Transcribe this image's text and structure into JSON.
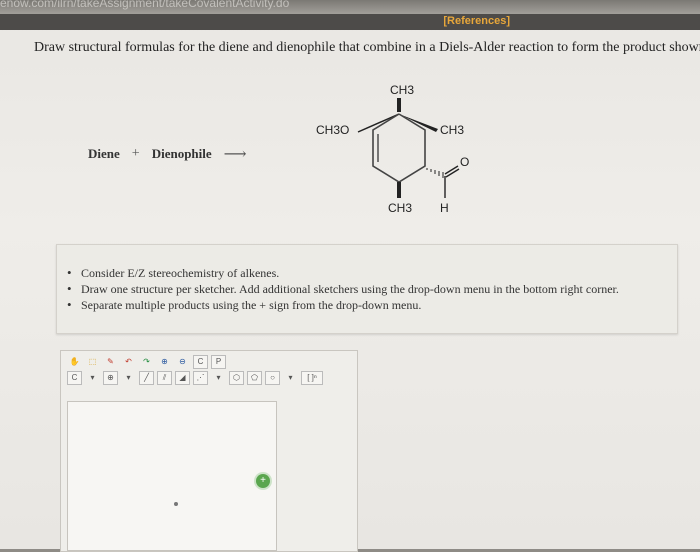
{
  "browser": {
    "url_fragment": "enow.com/ilrn/takeAssignment/takeCovalentActivity.do"
  },
  "header": {
    "references_label": "[References]"
  },
  "question": {
    "prompt": "Draw structural formulas for the diene and dienophile that combine in a Diels-Alder reaction to form the product shown.",
    "diene_label": "Diene",
    "plus": "+",
    "dienophile_label": "Dienophile",
    "arrow": "⟶"
  },
  "molecule": {
    "labels": {
      "top": "CH3",
      "left": "CH3O",
      "right": "CH3",
      "bottom": "CH3",
      "aldehyde_o": "O",
      "aldehyde_h": "H"
    }
  },
  "instructions": {
    "items": [
      "Consider E/Z stereochemistry of alkenes.",
      "Draw one structure per sketcher. Add additional sketchers using the drop-down menu in the bottom right corner.",
      "Separate multiple products using the + sign from the drop-down menu."
    ]
  },
  "sketcher": {
    "row1_icons": [
      "hand-icon",
      "select-icon",
      "eraser-icon",
      "undo-icon",
      "redo-icon",
      "zoom-in-icon",
      "zoom-out-icon",
      "clean-icon",
      "periodic-icon"
    ],
    "row1_text": {
      "clean": "C",
      "periodic": "P"
    },
    "row2": {
      "element": "C",
      "charge": "⊕",
      "ring_bracket": "[ ]ⁿ"
    },
    "add_button": "+"
  }
}
